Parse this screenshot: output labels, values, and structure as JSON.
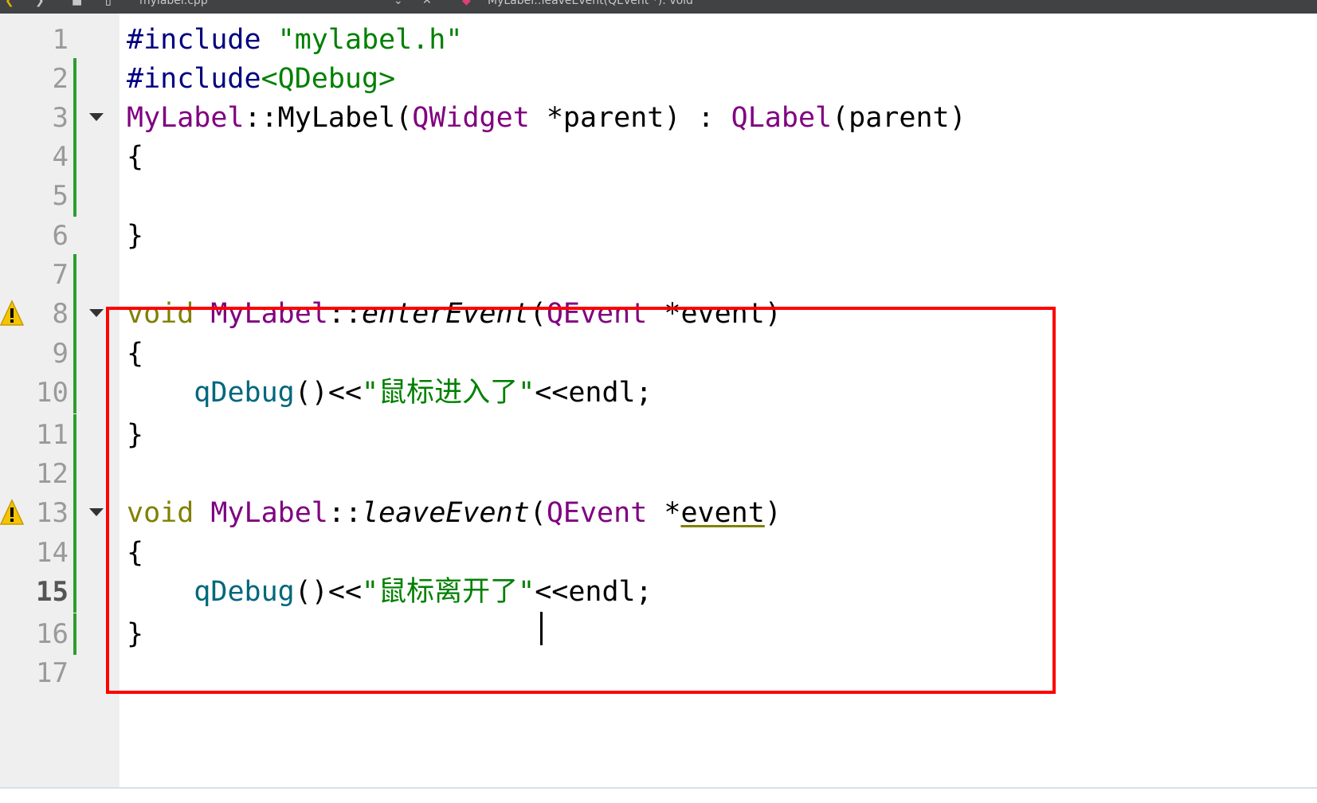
{
  "toolbar": {
    "file_name": "mylabel.cpp",
    "symbol": "MyLabel::leaveEvent(QEvent *): void"
  },
  "editor": {
    "current_line": 15,
    "lines": [
      {
        "num": "1"
      },
      {
        "num": "2"
      },
      {
        "num": "3"
      },
      {
        "num": "4"
      },
      {
        "num": "5"
      },
      {
        "num": "6"
      },
      {
        "num": "7"
      },
      {
        "num": "8"
      },
      {
        "num": "9"
      },
      {
        "num": "10"
      },
      {
        "num": "11"
      },
      {
        "num": "12"
      },
      {
        "num": "13"
      },
      {
        "num": "14"
      },
      {
        "num": "15"
      },
      {
        "num": "16"
      },
      {
        "num": "17"
      }
    ],
    "code": {
      "l1": {
        "directive": "#include",
        "path": "\"mylabel.h\""
      },
      "l2": {
        "directive": "#include",
        "path": "<QDebug>"
      },
      "l3": {
        "cls": "MyLabel",
        "scope": "::",
        "name": "MyLabel",
        "open": "(",
        "ptype": "QWidget",
        "param": " *parent) : ",
        "base": "QLabel",
        "rest": "(parent)"
      },
      "l4": "{",
      "l6": "}",
      "l8": {
        "kw": "void",
        "cls": "MyLabel",
        "scope": "::",
        "fn": "enterEvent",
        "open": "(",
        "ptype": "QEvent",
        "star": " *",
        "param": "event",
        "close": ")"
      },
      "l9": "{",
      "l10": {
        "indent": "    ",
        "fn": "qDebug",
        "op": "()<<",
        "str": "\"鼠标进入了\"",
        "rest": "<<endl;"
      },
      "l11": "}",
      "l13": {
        "kw": "void",
        "cls": "MyLabel",
        "scope": "::",
        "fn": "leaveEvent",
        "open": "(",
        "ptype": "QEvent",
        "star": " *",
        "param": "event",
        "close": ")"
      },
      "l14": "{",
      "l15": {
        "indent": "    ",
        "fn": "qDebug",
        "op": "()<<",
        "str": "\"鼠标离开了\"",
        "rest": "<<endl;"
      },
      "l16": "}"
    }
  },
  "colors": {
    "keyword": "#808000",
    "type": "#800080",
    "string": "#008000",
    "preprocessor": "#000080",
    "highlight_box": "#ff0000",
    "change_bar": "#2e9e2e"
  }
}
